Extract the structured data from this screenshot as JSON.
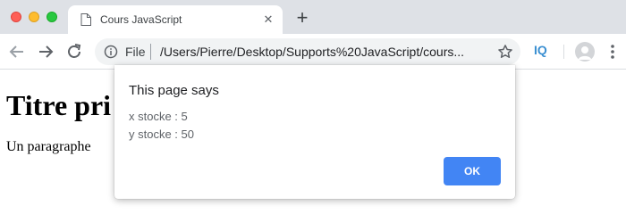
{
  "browser": {
    "tab": {
      "title": "Cours JavaScript"
    },
    "address_bar": {
      "scheme_label": "File",
      "url": "/Users/Pierre/Desktop/Supports%20JavaScript/cours..."
    },
    "extension_label": "IQ",
    "icons": {
      "close": "close-window-icon",
      "minimize": "minimize-window-icon",
      "maximize": "maximize-window-icon",
      "page": "page-icon",
      "tab_close": "close-tab-icon",
      "new_tab": "plus-icon",
      "back": "back-arrow-icon",
      "forward": "forward-arrow-icon",
      "reload": "reload-icon",
      "info": "info-icon",
      "bookmark": "star-icon",
      "profile": "avatar-icon",
      "menu": "more-vertical-icon"
    }
  },
  "page": {
    "heading": "Titre pri",
    "paragraph": "Un paragraphe"
  },
  "dialog": {
    "title": "This page says",
    "lines": [
      "x stocke : 5",
      "y stocke : 50"
    ],
    "ok_label": "OK"
  },
  "colors": {
    "accent": "#4285f4",
    "tabstrip": "#dee1e6",
    "traffic_red": "#fe5f57",
    "traffic_yellow": "#febc2e",
    "traffic_green": "#28c840"
  }
}
